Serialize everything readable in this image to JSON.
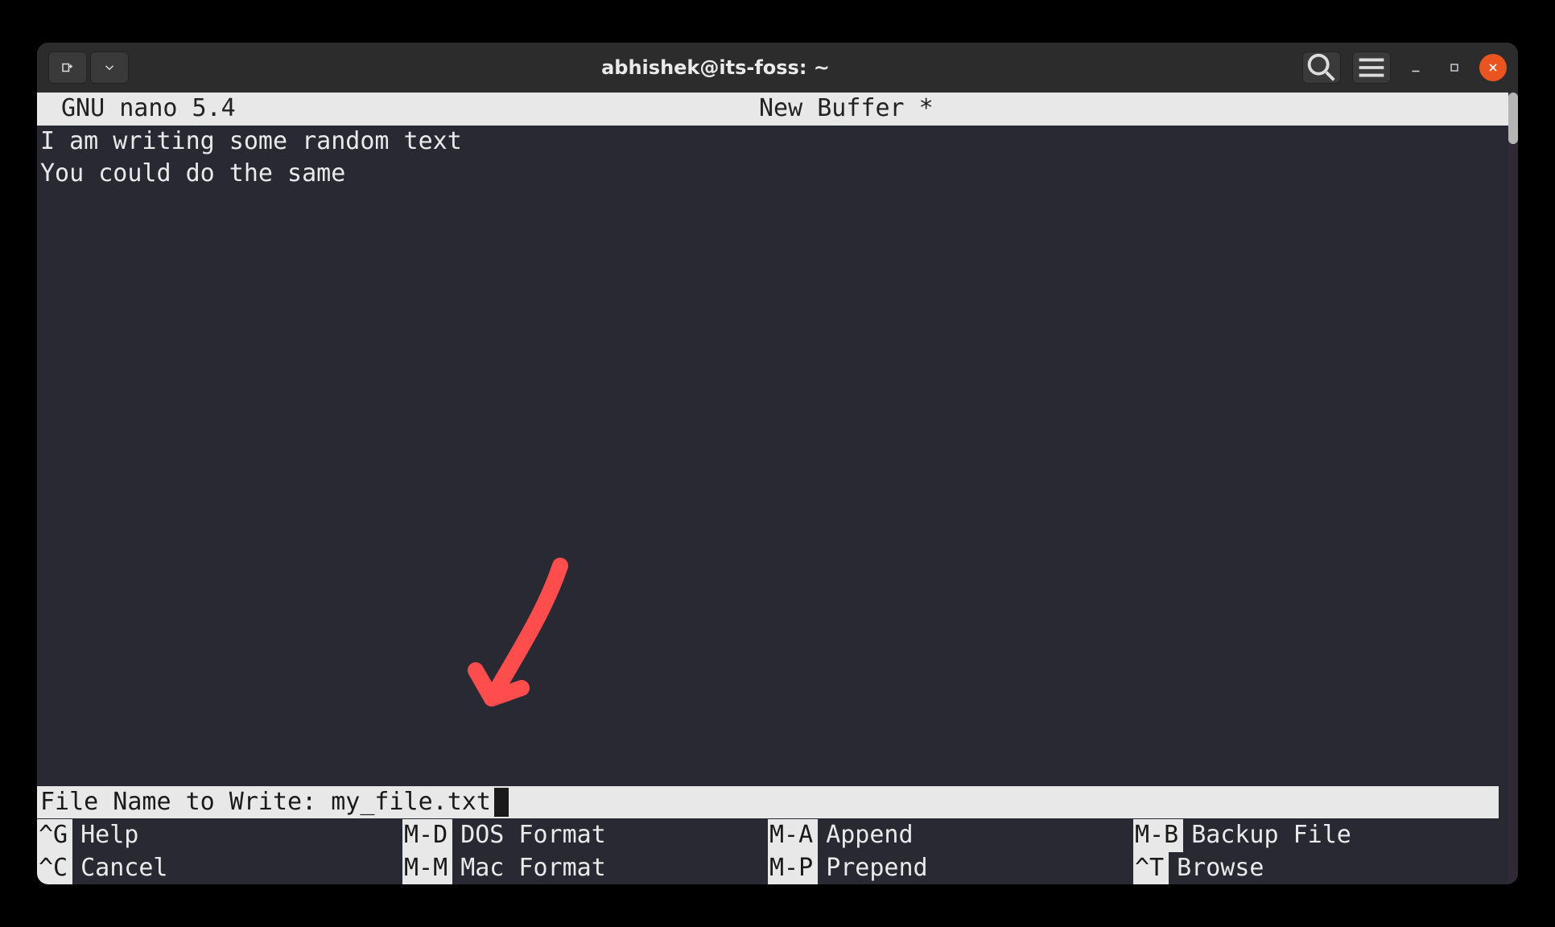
{
  "titlebar": {
    "title": "abhishek@its-foss: ~"
  },
  "nano": {
    "version_label": "GNU nano 5.4",
    "buffer_label": "New Buffer *",
    "content_line1": "I am writing some random text",
    "content_line2": "You could do the same",
    "prompt_label": "File Name to Write: ",
    "prompt_value": "my_file.txt"
  },
  "shortcuts": {
    "row1": [
      {
        "key": "^G",
        "label": "Help"
      },
      {
        "key": "M-D",
        "label": "DOS Format"
      },
      {
        "key": "M-A",
        "label": "Append"
      },
      {
        "key": "M-B",
        "label": "Backup File"
      }
    ],
    "row2": [
      {
        "key": "^C",
        "label": "Cancel"
      },
      {
        "key": "M-M",
        "label": "Mac Format"
      },
      {
        "key": "M-P",
        "label": "Prepend"
      },
      {
        "key": "^T",
        "label": "Browse"
      }
    ]
  }
}
